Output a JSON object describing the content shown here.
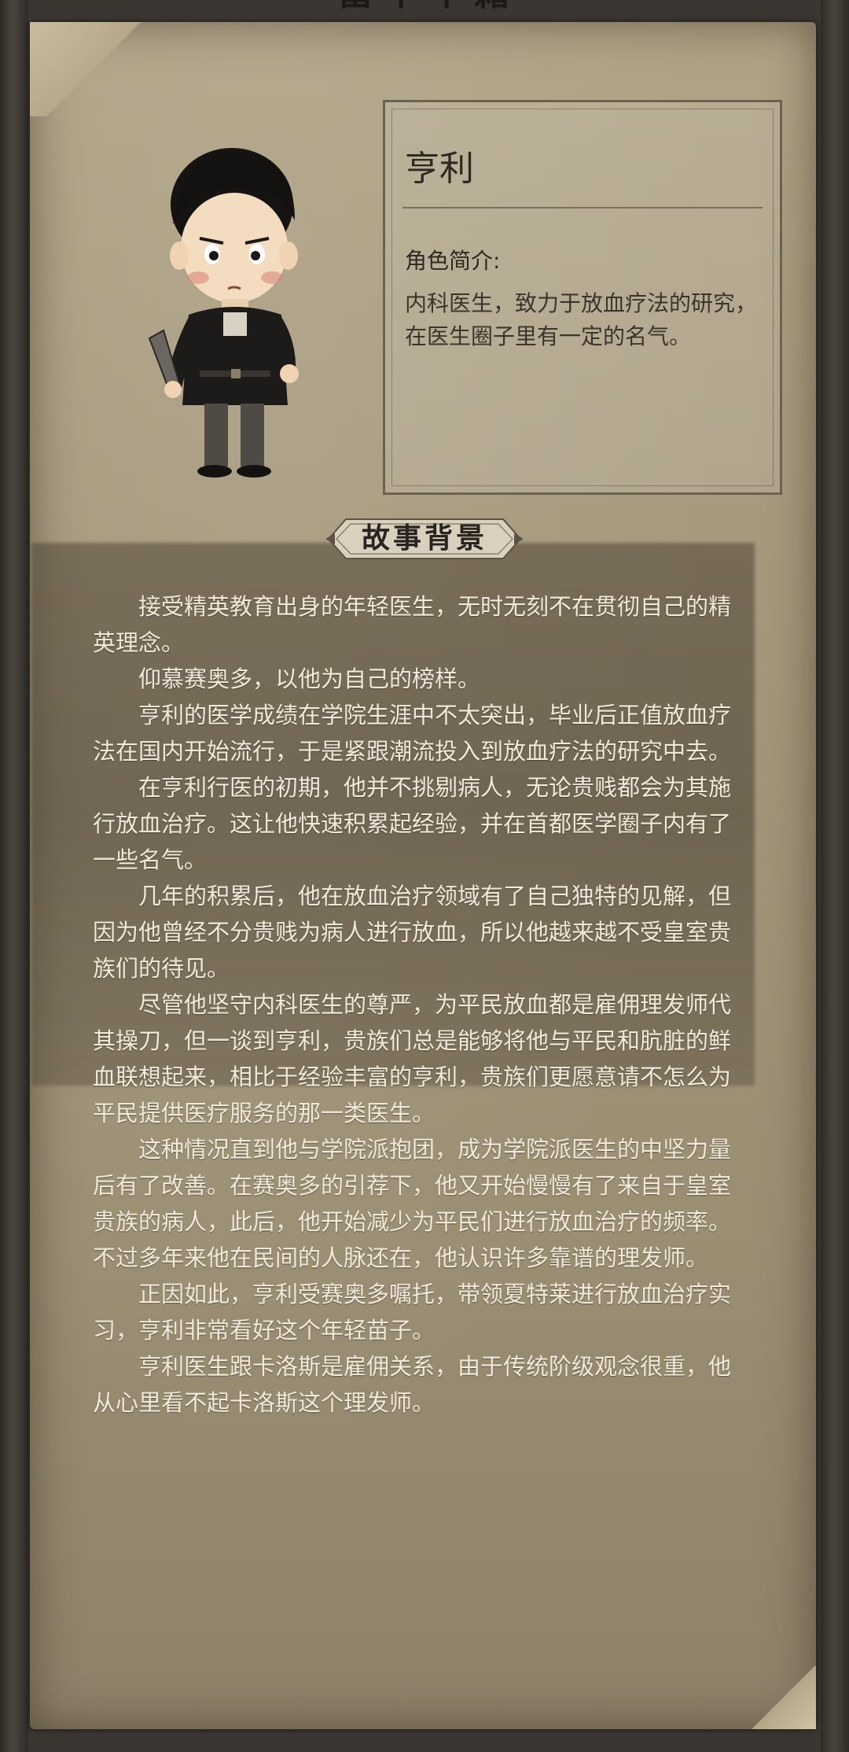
{
  "header": {
    "title_stub": "富甲华籍"
  },
  "character": {
    "name": "亨利",
    "intro_label": "角色简介:",
    "intro_text": "内科医生，致力于放血疗法的研究，在医生圈子里有一定的名气。"
  },
  "story": {
    "section_title": "故事背景",
    "paragraphs": [
      "接受精英教育出身的年轻医生，无时无刻不在贯彻自己的精英理念。",
      "仰慕赛奥多，以他为自己的榜样。",
      "亨利的医学成绩在学院生涯中不太突出，毕业后正值放血疗法在国内开始流行，于是紧跟潮流投入到放血疗法的研究中去。",
      "在亨利行医的初期，他并不挑剔病人，无论贵贱都会为其施行放血治疗。这让他快速积累起经验，并在首都医学圈子内有了一些名气。",
      "几年的积累后，他在放血治疗领域有了自己独特的见解，但因为他曾经不分贵贱为病人进行放血，所以他越来越不受皇室贵族们的待见。",
      "尽管他坚守内科医生的尊严，为平民放血都是雇佣理发师代其操刀，但一谈到亨利，贵族们总是能够将他与平民和肮脏的鲜血联想起来，相比于经验丰富的亨利，贵族们更愿意请不怎么为平民提供医疗服务的那一类医生。",
      "这种情况直到他与学院派抱团，成为学院派医生的中坚力量后有了改善。在赛奥多的引荐下，他又开始慢慢有了来自于皇室贵族的病人，此后，他开始减少为平民们进行放血治疗的频率。不过多年来他在民间的人脉还在，他认识许多靠谱的理发师。",
      "正因如此，亨利受赛奥多嘱托，带领夏特莱进行放血治疗实习，亨利非常看好这个年轻苗子。",
      "亨利医生跟卡洛斯是雇佣关系，由于传统阶级观念很重，他从心里看不起卡洛斯这个理发师。"
    ]
  },
  "colors": {
    "parchment": "#a6997d",
    "frame": "#3a3631",
    "story_text": "#f1eadb",
    "panel_text": "#2f2922"
  },
  "icons": {
    "portrait": "character-portrait-henry",
    "ornament": "section-ornament"
  }
}
